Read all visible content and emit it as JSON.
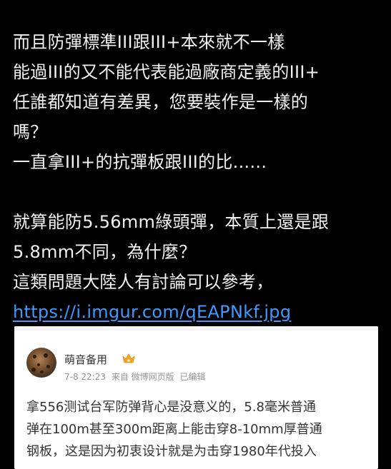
{
  "post": {
    "lines": [
      "而且防彈標準III跟III+本來就不一樣",
      "能過III的又不能代表能過廠商定義的III+",
      "任誰都知道有差異，您要裝作是一樣的",
      "嗎？",
      "一直拿III+的抗彈板跟III的比......"
    ],
    "lines2": [
      "就算能防5.56mm綠頭彈，本質上還是跟",
      "5.8mm不同，為什麼？",
      "這類問題大陸人有討論可以參考，"
    ],
    "link": "https://i.imgur.com/qEAPNkf.jpg"
  },
  "embed": {
    "username": "萌音备用",
    "timestamp": "7-8 22:23",
    "source": "来自 微博网页版",
    "edited": "已编辑",
    "text_lines": [
      "拿556测试台军防弹背心是没意义的，5.8毫米普通",
      "弹在100m甚至300m距离上能击穿8-10mm厚普通",
      "钢板，这是因为初衷设计就是为击穿1980年代投入"
    ],
    "badge_icon": "vip-crown-icon"
  },
  "colors": {
    "background": "#000000",
    "text": "#f2f2f2",
    "link": "#3d9bff",
    "card": "#ffffff"
  }
}
